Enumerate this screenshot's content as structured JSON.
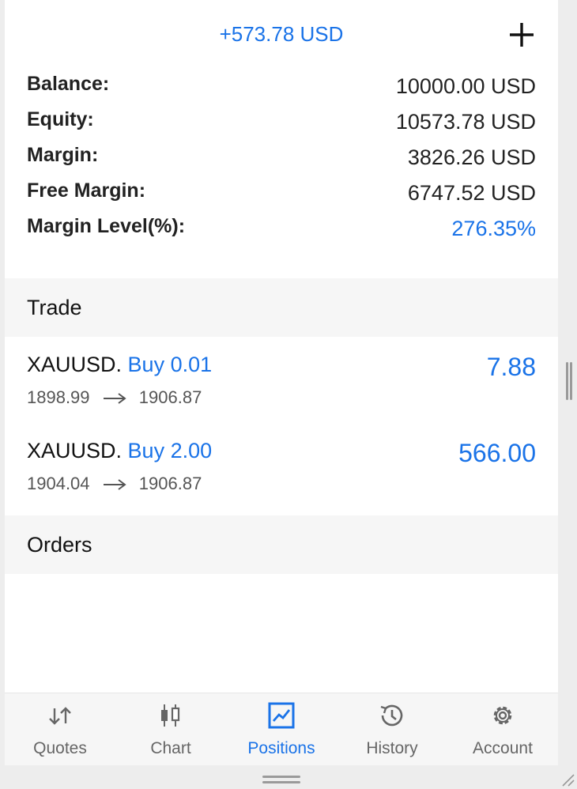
{
  "header": {
    "floating_profit": "+573.78 USD",
    "add_icon": "plus-icon"
  },
  "summary": [
    {
      "label": "Balance:",
      "value": "10000.00 USD"
    },
    {
      "label": "Equity:",
      "value": "10573.78 USD"
    },
    {
      "label": "Margin:",
      "value": "3826.26 USD"
    },
    {
      "label": "Free Margin:",
      "value": "6747.52 USD"
    },
    {
      "label": "Margin Level(%):",
      "value": "276.35%"
    }
  ],
  "sections": {
    "trade": "Trade",
    "orders": "Orders"
  },
  "trades": [
    {
      "symbol": "XAUUSD.",
      "action": "Buy 0.01",
      "open_price": "1898.99",
      "current_price": "1906.87",
      "profit": "7.88"
    },
    {
      "symbol": "XAUUSD.",
      "action": "Buy 2.00",
      "open_price": "1904.04",
      "current_price": "1906.87",
      "profit": "566.00"
    }
  ],
  "nav": {
    "items": [
      {
        "label": "Quotes",
        "icon": "quotes-arrows-icon"
      },
      {
        "label": "Chart",
        "icon": "candlestick-chart-icon"
      },
      {
        "label": "Positions",
        "icon": "positions-trend-icon"
      },
      {
        "label": "History",
        "icon": "history-clock-icon"
      },
      {
        "label": "Account",
        "icon": "gear-icon"
      }
    ],
    "active": "Positions"
  },
  "colors": {
    "accent": "#1a73e8",
    "text": "#222222",
    "muted": "#666666",
    "section_bg": "#f6f6f6"
  }
}
